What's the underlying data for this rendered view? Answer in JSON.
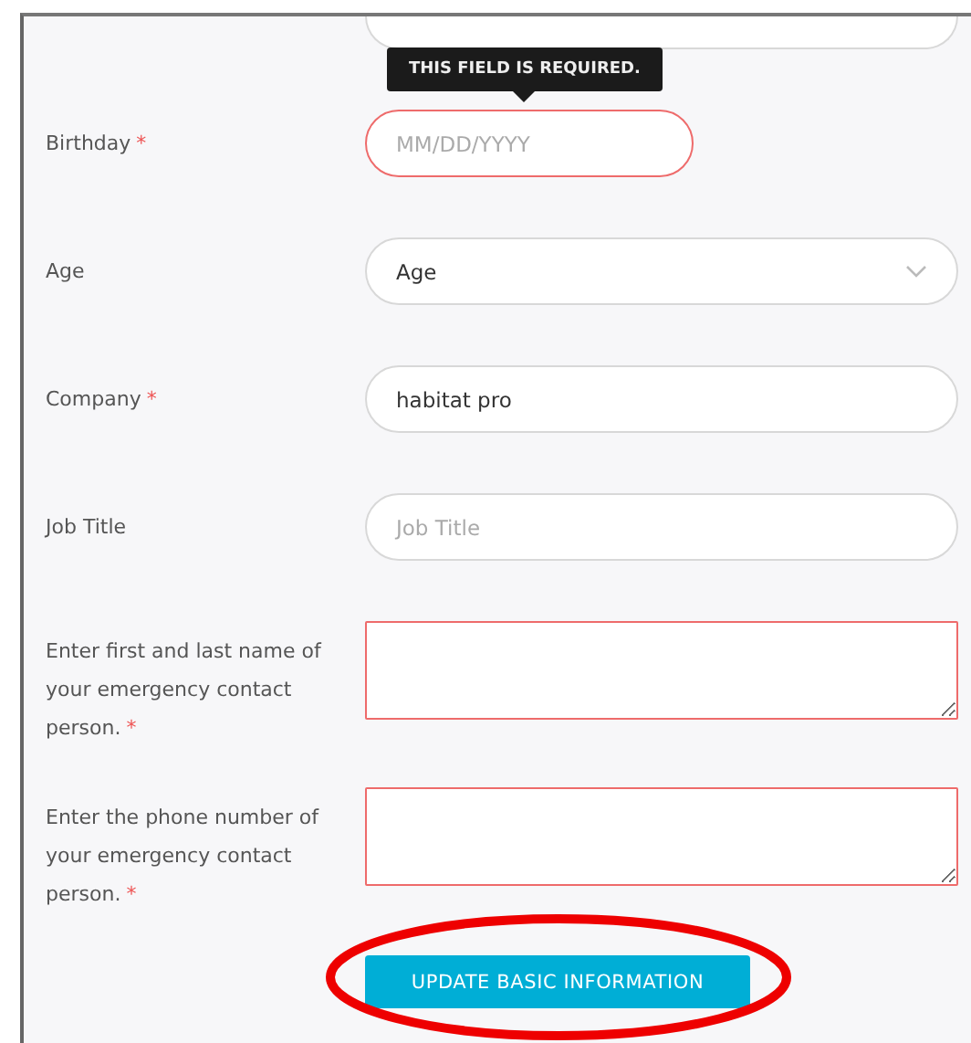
{
  "fields": [
    {
      "kind": "cut",
      "invalid": false
    },
    {
      "kind": "date",
      "label": "Birthday",
      "required_mark": "*",
      "invalid": true,
      "placeholder": "MM/DD/YYYY",
      "tooltip": "THIS FIELD IS REQUIRED."
    },
    {
      "kind": "select",
      "label": "Age",
      "invalid": false,
      "value": "Age"
    },
    {
      "kind": "text",
      "label": "Company",
      "required_mark": "*",
      "invalid": false,
      "value": "habitat pro"
    },
    {
      "kind": "text",
      "label": "Job Title",
      "invalid": false,
      "placeholder": "Job Title"
    },
    {
      "kind": "textarea",
      "label": "Enter first and last name of your emergency contact person.",
      "required_mark": "*",
      "invalid": true
    },
    {
      "kind": "textarea",
      "label": "Enter the phone number of your emergency contact person.",
      "required_mark": "*",
      "invalid": true
    }
  ],
  "button": {
    "label": "UPDATE BASIC INFORMATION",
    "highlighted": true
  }
}
